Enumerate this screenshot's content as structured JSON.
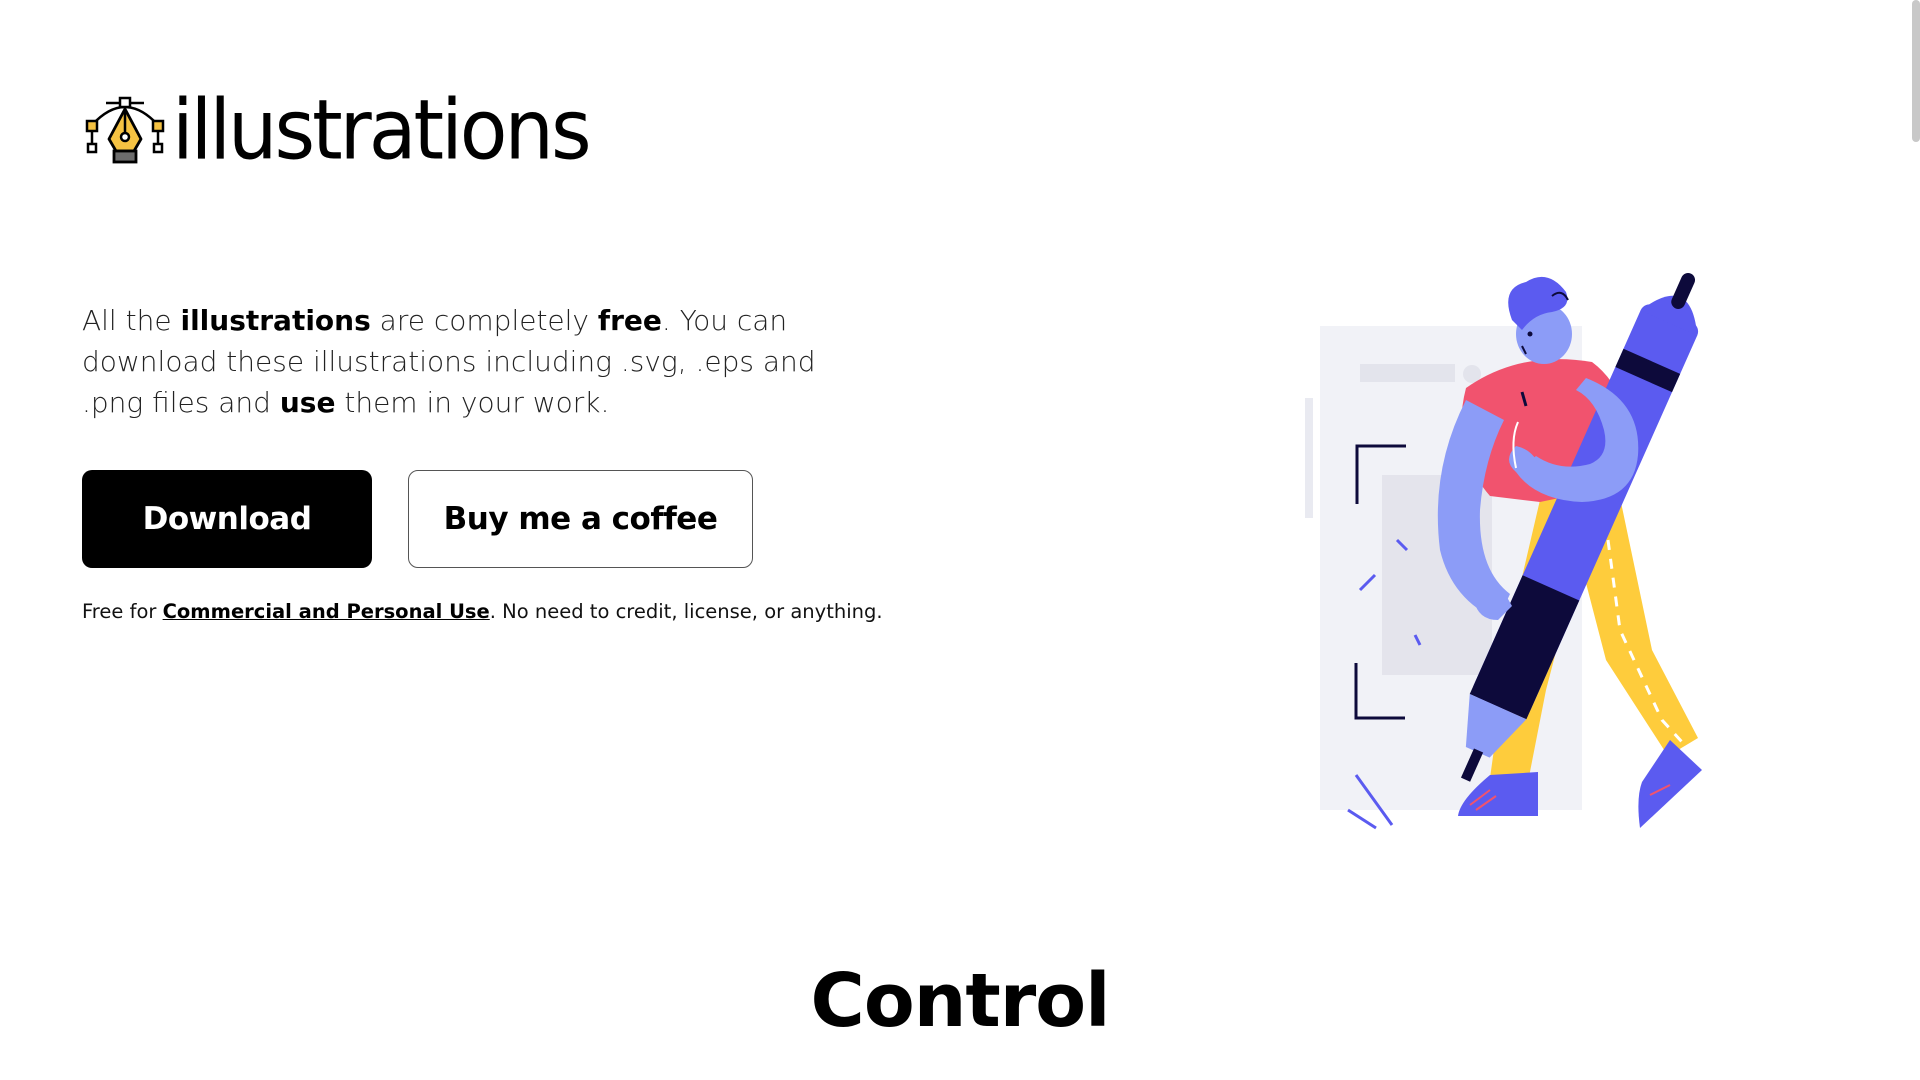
{
  "brand": {
    "logo_text": "illustrations",
    "logo_icon": "pen-tool-icon"
  },
  "hero": {
    "intro_segments": [
      {
        "text": "All the ",
        "bold": false
      },
      {
        "text": "illustrations",
        "bold": true
      },
      {
        "text": " are completely ",
        "bold": false
      },
      {
        "text": "free",
        "bold": true
      },
      {
        "text": ". You can download these illustrations including .svg, .eps and .png files and ",
        "bold": false
      },
      {
        "text": "use",
        "bold": true
      },
      {
        "text": " them in your work.",
        "bold": false
      }
    ],
    "download_label": "Download",
    "coffee_label": "Buy me a coffee",
    "license_prefix": "Free for ",
    "license_link": "Commercial and Personal Use",
    "license_suffix": ". No need to credit, license, or anything.",
    "illustration": "person-holding-giant-pen-illustration"
  },
  "section": {
    "title": "Control"
  },
  "colors": {
    "primary_button_bg": "#000000",
    "illustration_purple": "#5b5bf0",
    "illustration_light_purple": "#8c9cf7",
    "illustration_red": "#f1536e",
    "illustration_yellow": "#fecc3c",
    "illustration_navy": "#0d0a3b",
    "logo_yellow": "#f5c242"
  }
}
